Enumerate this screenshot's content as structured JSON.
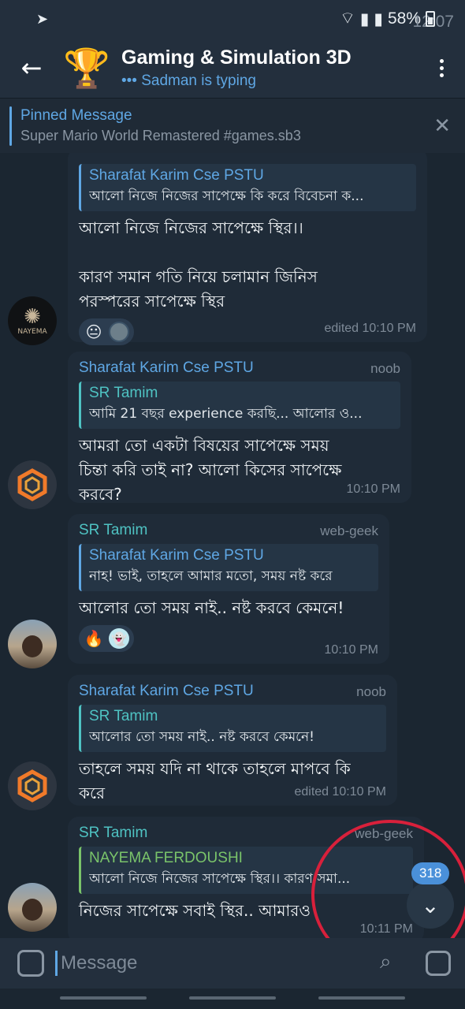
{
  "status": {
    "time": "12:07",
    "battery": "58%"
  },
  "header": {
    "title": "Gaming & Simulation 3D",
    "typing": "••• Sadman is typing"
  },
  "pinned": {
    "title": "Pinned Message",
    "text": "Super Mario World Remastered #games.sb3"
  },
  "messages": [
    {
      "reply_name": "Sharafat Karim Cse PSTU",
      "reply_text": "আলো নিজে নিজের সাপেক্ষে কি করে বিবেচনা ক...",
      "text_lines": [
        "আলো নিজে নিজের সাপেক্ষে স্থির।।",
        "",
        "কারণ সমান গতি নিয়ে চলামান জিনিস",
        "পরস্পরের সাপেক্ষে স্থির"
      ],
      "reactions": [
        "😐"
      ],
      "time": "edited 10:10 PM",
      "avatar_label": "NAYEMA"
    },
    {
      "sender": "Sharafat Karim Cse PSTU",
      "role": "noob",
      "reply_name": "SR Tamim",
      "reply_text": "আমি 21 বছর experience করছি... আলোর ও...",
      "text_lines": [
        "আমরা তো একটা বিষয়ের সাপেক্ষে সময়",
        "চিন্তা করি তাই না? আলো কিসের সাপেক্ষে",
        "করবে?"
      ],
      "time": "10:10 PM"
    },
    {
      "sender": "SR Tamim",
      "role": "web-geek",
      "reply_name": "Sharafat Karim Cse PSTU",
      "reply_text": "নাহ! ভাই, তাহলে আমার মতো, সময় নষ্ট করে",
      "text_lines": [
        "আলোর তো সময় নাই.. নষ্ট করবে কেমনে!"
      ],
      "reactions": [
        "🔥",
        "👻"
      ],
      "time": "10:10 PM"
    },
    {
      "sender": "Sharafat Karim Cse PSTU",
      "role": "noob",
      "reply_name": "SR Tamim",
      "reply_text": "আলোর তো সময় নাই.. নষ্ট করবে কেমনে!",
      "text_lines": [
        "তাহলে সময় যদি না থাকে তাহলে মাপবে কি",
        "করে"
      ],
      "time": "edited 10:10 PM"
    },
    {
      "sender": "SR Tamim",
      "role": "web-geek",
      "reply_name": "NAYEMA FERDOUSHI",
      "reply_text": "আলো নিজে নিজের সাপেক্ষে স্থির।।  কারণ সমা...",
      "text_lines": [
        "নিজের সাপেক্ষে সবাই স্থির.. আমারও"
      ],
      "time": "10:11 PM"
    }
  ],
  "scroll": {
    "unread_count": "318"
  },
  "composer": {
    "placeholder": "Message"
  },
  "colors": {
    "accent": "#5fa7e4",
    "teal_name": "#4fc3c3",
    "green_name": "#7ac46a",
    "annotation_red": "#d8203b"
  }
}
